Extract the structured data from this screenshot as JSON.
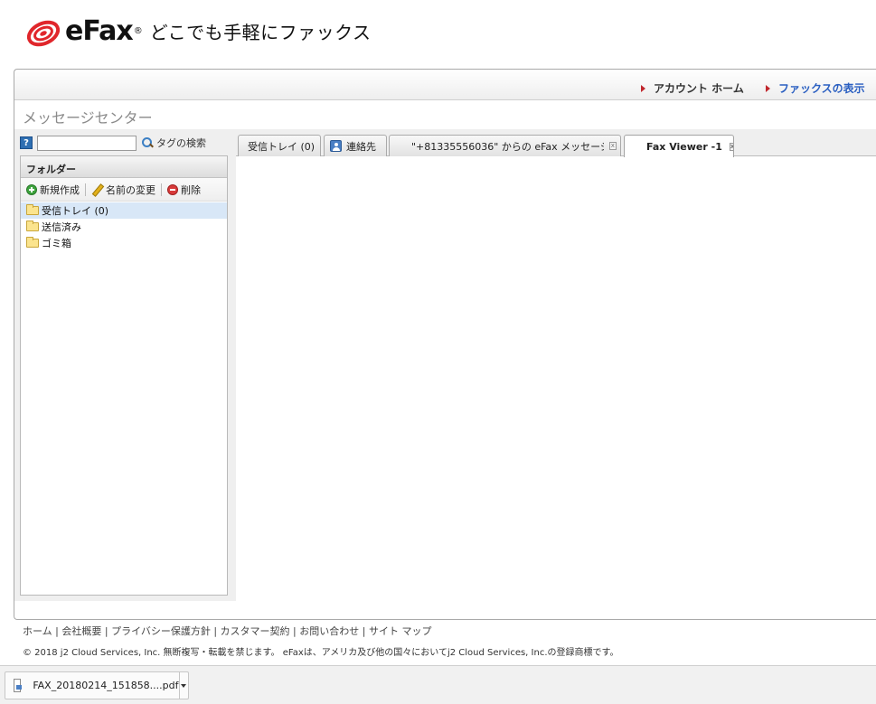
{
  "brand": {
    "logo_text": "eFax",
    "registered": "®",
    "tagline": "どこでも手軽にファックス",
    "accent_color": "#e0262b"
  },
  "top_nav": {
    "account_home": "アカウント ホーム",
    "view_faxes": "ファックスの表示"
  },
  "section_title": "メッセージセンター",
  "search": {
    "help_label": "?",
    "input_value": "",
    "tag_search_label": "タグの検索"
  },
  "folders": {
    "header": "フォルダー",
    "tools": {
      "new": "新規作成",
      "rename": "名前の変更",
      "delete": "削除"
    },
    "items": [
      {
        "label": "受信トレイ (0)",
        "selected": true
      },
      {
        "label": "送信済み"
      },
      {
        "label": "ゴミ箱"
      }
    ]
  },
  "tabs": [
    {
      "label": "受信トレイ (0)"
    },
    {
      "label": "連絡先"
    },
    {
      "label": "\"+81335556036\" からの eFax メッセージ..."
    },
    {
      "label": "Fax Viewer -1"
    }
  ],
  "tab_close_glyph": "x",
  "footer": {
    "links": "ホーム | 会社概要 | プライバシー保護方針 | カスタマー契約 | お問い合わせ | サイト マップ",
    "copyright": "© 2018 j2 Cloud Services, Inc. 無断複写・転載を禁じます。 eFaxは、アメリカ及び他の国々においてj2 Cloud Services, Inc.の登録商標です。"
  },
  "download": {
    "filename": "FAX_20180214_151858....pdf"
  }
}
